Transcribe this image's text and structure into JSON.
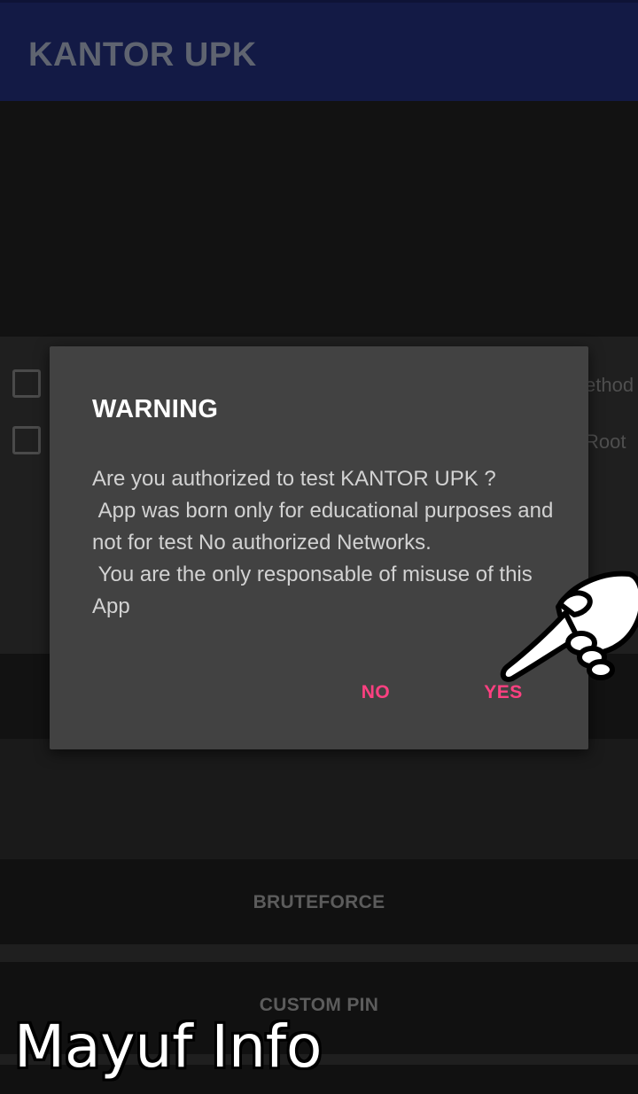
{
  "app": {
    "title": "KANTOR UPK"
  },
  "options": [
    {
      "label": "ethod"
    },
    {
      "label": "Root"
    }
  ],
  "buttons": {
    "bruteforce": "BRUTEFORCE",
    "custom_pin": "CUSTOM PIN"
  },
  "dialog": {
    "title": "WARNING",
    "message": "Are you authorized to test KANTOR UPK ?\n App was born only for educational purposes and not for test No authorized Networks.\n You are the only responsable of misuse of this App",
    "negative": "NO",
    "positive": "YES"
  },
  "overlay": {
    "watermark": "Mayuf Info",
    "pointer_icon": "pointing-hand-icon"
  },
  "colors": {
    "appbar": "#131a45",
    "dialog_bg": "#424242",
    "accent": "#ff4081"
  }
}
